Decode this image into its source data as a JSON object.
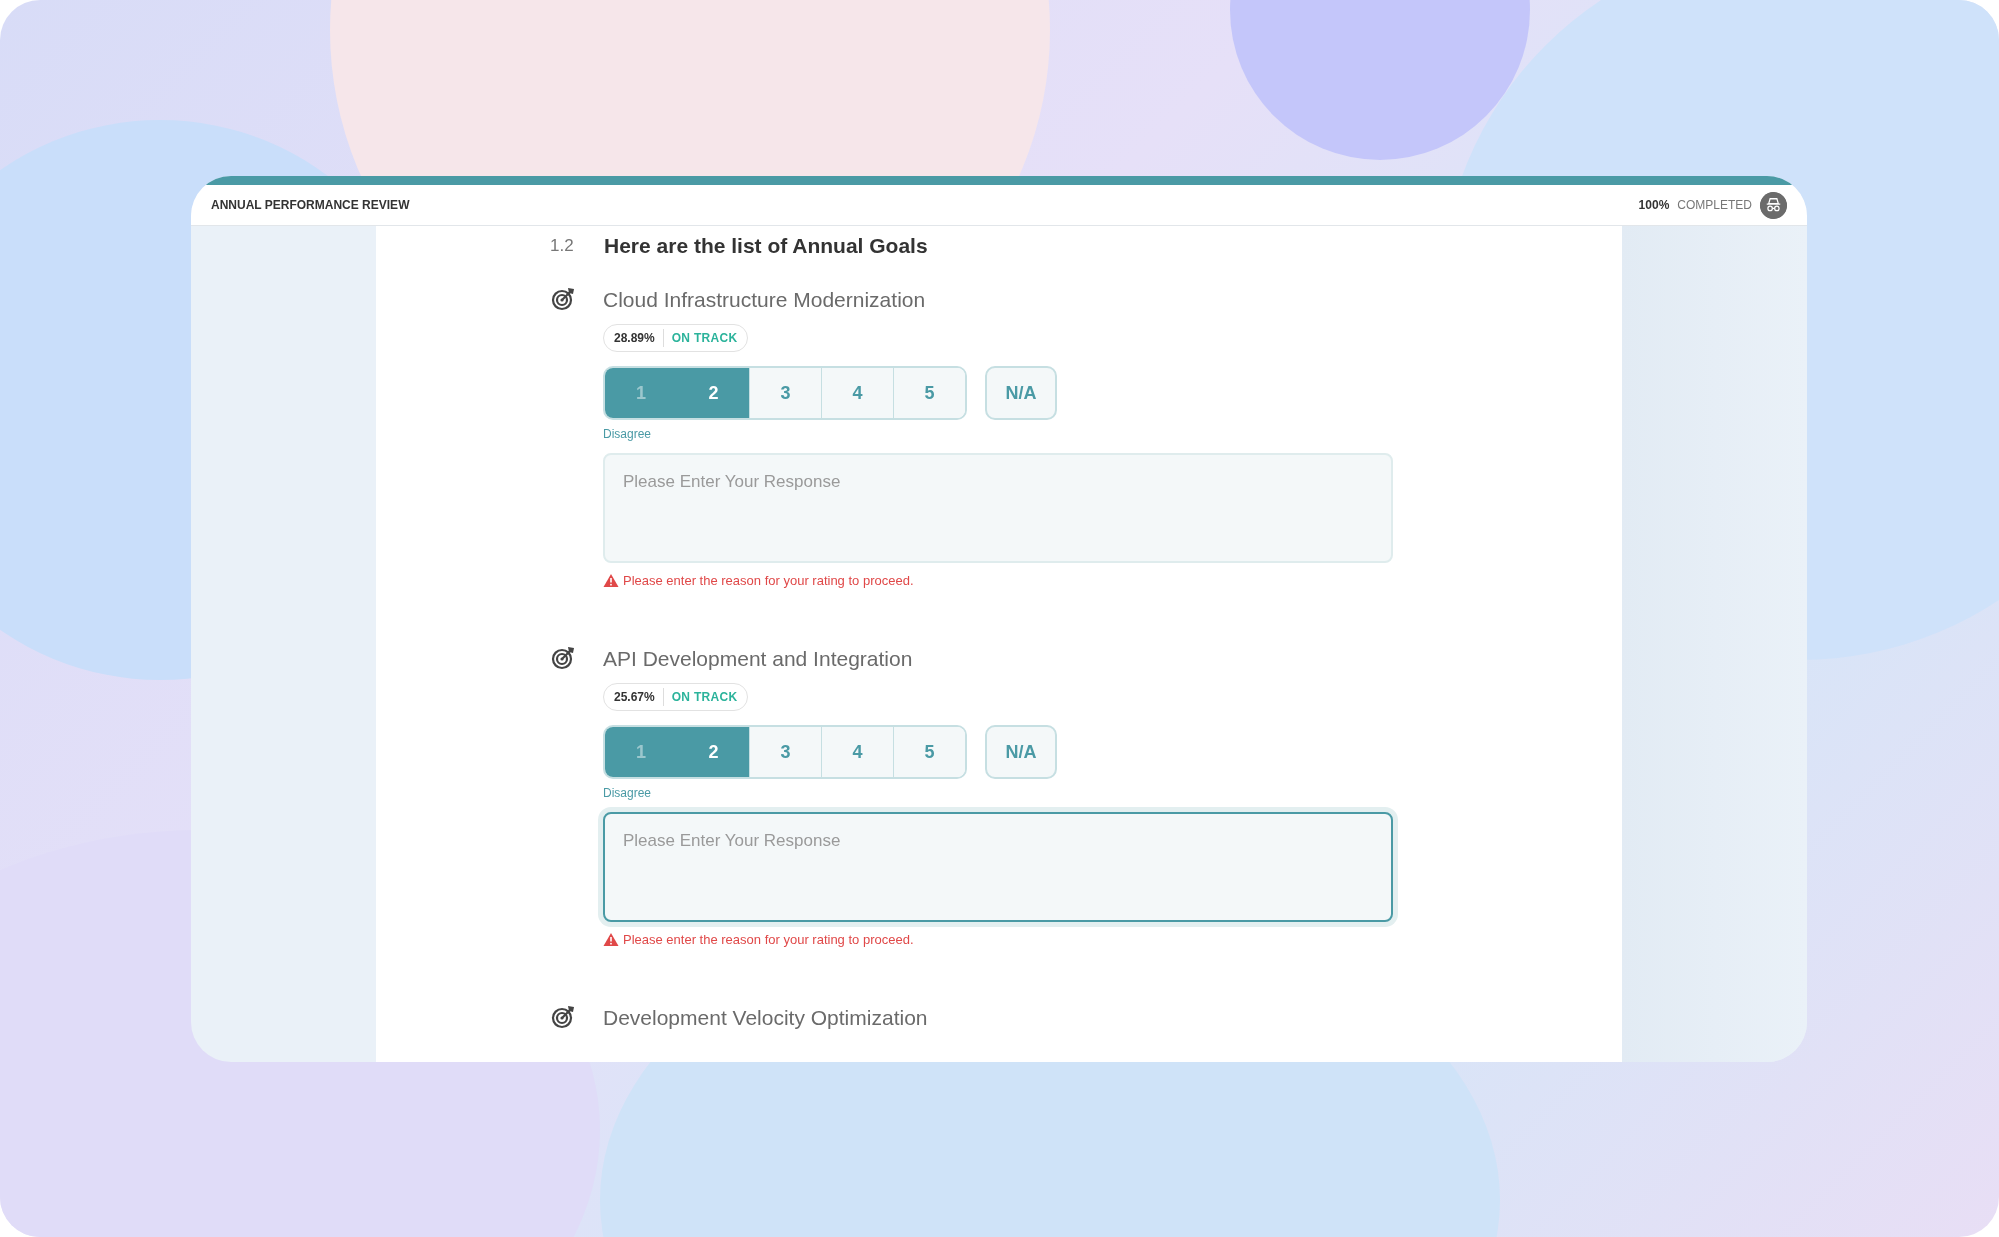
{
  "header": {
    "title": "ANNUAL PERFORMANCE REVIEW",
    "progress": "100%",
    "progress_label": "COMPLETED"
  },
  "section": {
    "number": "1.2",
    "title": "Here are the list of Annual Goals"
  },
  "goals": [
    {
      "title": "Cloud Infrastructure Modernization",
      "percent": "28.89%",
      "status": "ON TRACK",
      "scale": [
        {
          "label": "1",
          "selected": false
        },
        {
          "label": "2",
          "selected": true
        },
        {
          "label": "3",
          "selected": false
        },
        {
          "label": "4",
          "selected": false
        },
        {
          "label": "5",
          "selected": false
        }
      ],
      "na": {
        "label": "N/A",
        "selected": false
      },
      "rating_caption": "Disagree",
      "response": {
        "placeholder": "Please Enter Your Response",
        "focused": false
      },
      "error": "Please enter the reason for your rating to proceed."
    },
    {
      "title": "API Development and Integration",
      "percent": "25.67%",
      "status": "ON TRACK",
      "scale": [
        {
          "label": "1",
          "selected": false
        },
        {
          "label": "2",
          "selected": true
        },
        {
          "label": "3",
          "selected": false
        },
        {
          "label": "4",
          "selected": false
        },
        {
          "label": "5",
          "selected": false
        }
      ],
      "na": {
        "label": "N/A",
        "selected": false
      },
      "rating_caption": "Disagree",
      "response": {
        "placeholder": "Please Enter Your Response",
        "focused": true
      },
      "error": "Please enter the reason for your rating to proceed."
    },
    {
      "title": "Development Velocity Optimization"
    }
  ]
}
